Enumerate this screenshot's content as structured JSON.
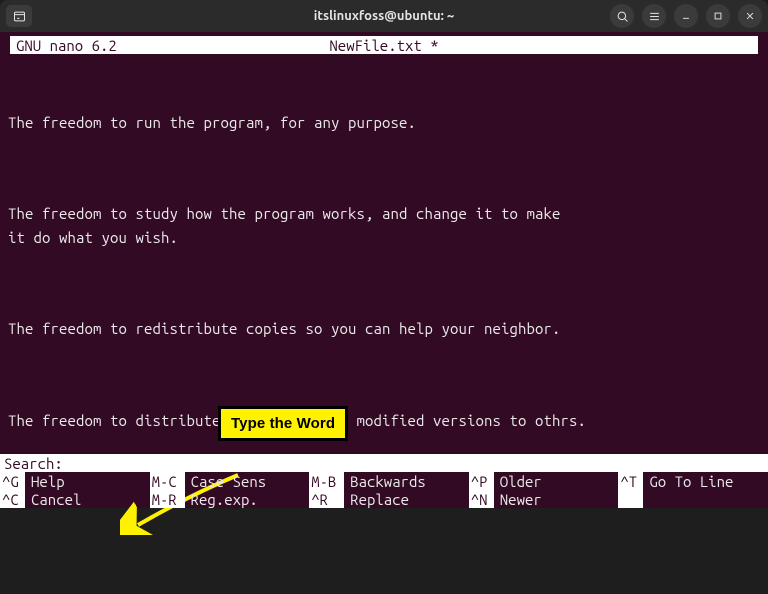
{
  "titlebar": {
    "title": "itslinuxfoss@ubuntu: ~"
  },
  "nano": {
    "app": "GNU nano 6.2",
    "filename": "NewFile.txt *"
  },
  "editor": {
    "p1": "The freedom to run the program, for any purpose.",
    "p2": "The freedom to study how the program works, and change it to make\nit do what you wish.",
    "p3": "The freedom to redistribute copies so you can help your neighbor.",
    "p4": "The freedom to distribute copies of your modified versions to othrs."
  },
  "search": {
    "label": "Search:",
    "value": ""
  },
  "shortcuts": {
    "row1": [
      {
        "key": "^G",
        "label": "Help"
      },
      {
        "key": "M-C",
        "label": "Case Sens"
      },
      {
        "key": "M-B",
        "label": "Backwards"
      },
      {
        "key": "^P",
        "label": "Older"
      },
      {
        "key": "^T",
        "label": "Go To Line"
      }
    ],
    "row2": [
      {
        "key": "^C",
        "label": "Cancel"
      },
      {
        "key": "M-R",
        "label": "Reg.exp."
      },
      {
        "key": "^R",
        "label": "Replace"
      },
      {
        "key": "^N",
        "label": "Newer"
      },
      {
        "key": "",
        "label": ""
      }
    ]
  },
  "annotation": {
    "text": "Type the Word"
  },
  "colors": {
    "terminal_bg": "#330a24",
    "text": "#eaeaea",
    "inverse_bg": "#ffffff",
    "annotation_bg": "#fff200"
  }
}
